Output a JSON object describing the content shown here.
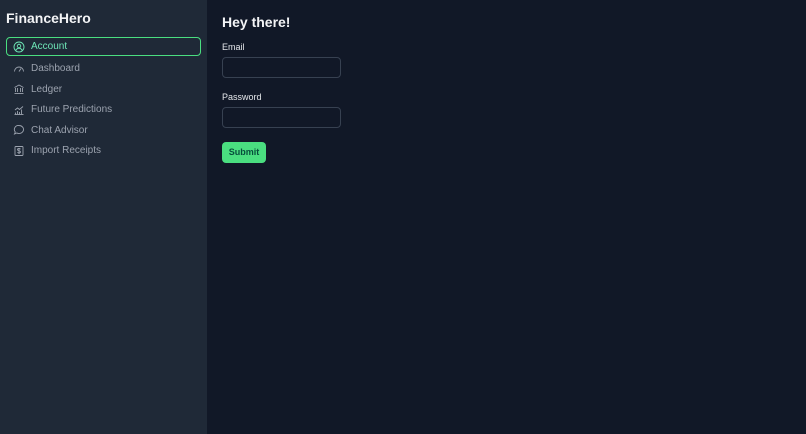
{
  "brand": "FinanceHero",
  "colors": {
    "accent": "#4ade80",
    "sidebar_bg": "#1f2937",
    "main_bg": "#111827"
  },
  "sidebar": {
    "items": [
      {
        "label": "Account",
        "icon": "user-circle-icon",
        "active": true
      },
      {
        "label": "Dashboard",
        "icon": "gauge-icon",
        "active": false
      },
      {
        "label": "Ledger",
        "icon": "bank-icon",
        "active": false
      },
      {
        "label": "Future Predictions",
        "icon": "bar-chart-icon",
        "active": false
      },
      {
        "label": "Chat Advisor",
        "icon": "chat-bubble-icon",
        "active": false
      },
      {
        "label": "Import Receipts",
        "icon": "receipt-icon",
        "active": false
      }
    ]
  },
  "main": {
    "greeting": "Hey there!",
    "form": {
      "email_label": "Email",
      "email_value": "",
      "password_label": "Password",
      "password_value": "",
      "submit_label": "Submit"
    }
  }
}
